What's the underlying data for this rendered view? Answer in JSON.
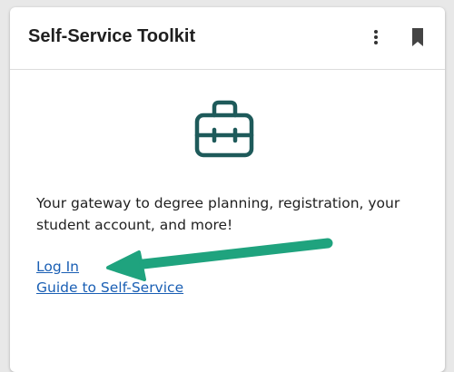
{
  "card": {
    "title": "Self-Service Toolkit",
    "description": "Your gateway to degree planning, registration, your student account, and more!",
    "links": [
      {
        "label": "Log In"
      },
      {
        "label": "Guide to Self-Service"
      }
    ]
  },
  "icons": {
    "menu": "more-vert-icon",
    "bookmark": "bookmark-icon",
    "toolbox": "toolbox-icon",
    "annotation": "arrow-pointer"
  },
  "colors": {
    "link": "#1a5fb4",
    "toolbox": "#1e5a5a",
    "arrow": "#1fa37e",
    "title": "#1f1f1f"
  }
}
